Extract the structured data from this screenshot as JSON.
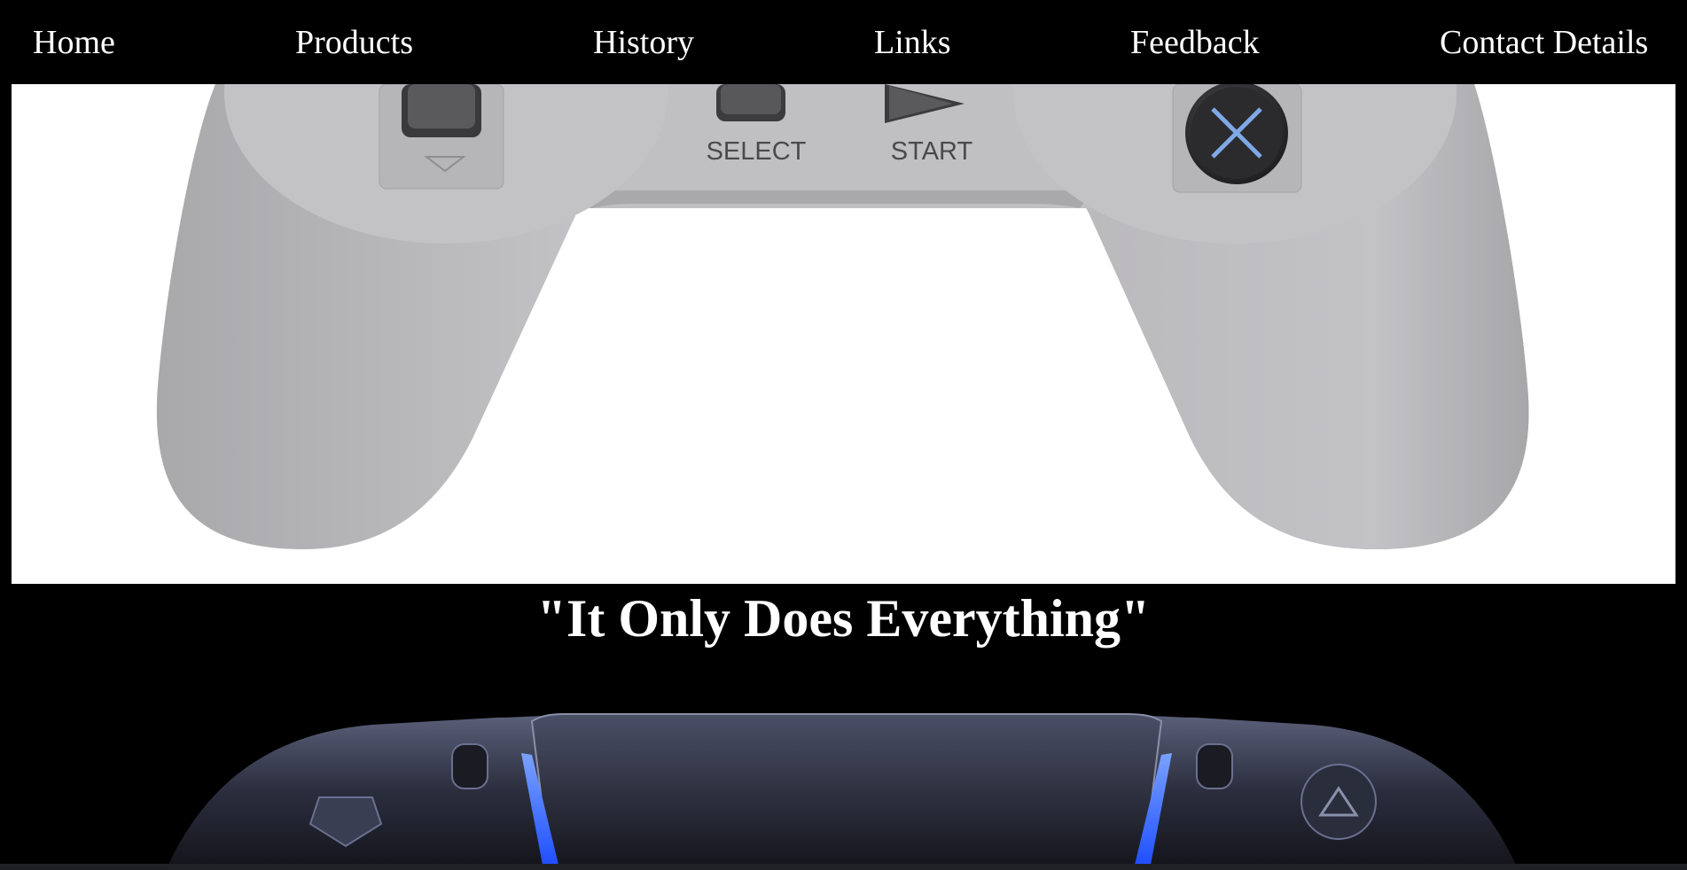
{
  "nav": {
    "items": [
      {
        "label": "Home"
      },
      {
        "label": "Products"
      },
      {
        "label": "History"
      },
      {
        "label": "Links"
      },
      {
        "label": "Feedback"
      },
      {
        "label": "Contact Details"
      }
    ]
  },
  "hero": {
    "select_label": "SELECT",
    "start_label": "START",
    "icon": "ps1-controller-image"
  },
  "tagline": "\"It Only Does Everything\"",
  "secondary_image": {
    "icon": "ps5-controller-image"
  },
  "colors": {
    "background": "#000000",
    "text": "#ffffff",
    "hero_background": "#ffffff",
    "controller_grey": "#b8b7ba",
    "ps5_blue_light": "#2f6bff"
  }
}
